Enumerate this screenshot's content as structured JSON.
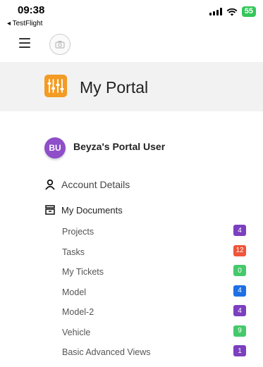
{
  "status_bar": {
    "time": "09:38",
    "back_label": "◂ TestFlight",
    "battery": "55",
    "battery_color": "#34c759"
  },
  "appbar": {
    "menu_icon": "hamburger-icon",
    "avatar_icon": "camera-placeholder-icon"
  },
  "header": {
    "title": "My Portal",
    "logo_color": "#f39b24"
  },
  "user": {
    "initials": "BU",
    "name": "Beyza's Portal User",
    "avatar_color": "#8e4fc9"
  },
  "menu": {
    "account_details": "Account Details",
    "my_documents": "My Documents"
  },
  "documents": [
    {
      "label": "Projects",
      "count": "4",
      "color": "#7b3fbf"
    },
    {
      "label": "Tasks",
      "count": "12",
      "color": "#f0553a"
    },
    {
      "label": "My Tickets",
      "count": "0",
      "color": "#45c96a"
    },
    {
      "label": "Model",
      "count": "4",
      "color": "#1f6fe5"
    },
    {
      "label": "Model-2",
      "count": "4",
      "color": "#7b3fbf"
    },
    {
      "label": "Vehicle",
      "count": "9",
      "color": "#45c96a"
    },
    {
      "label": "Basic Advanced Views",
      "count": "1",
      "color": "#7b3fbf"
    }
  ]
}
